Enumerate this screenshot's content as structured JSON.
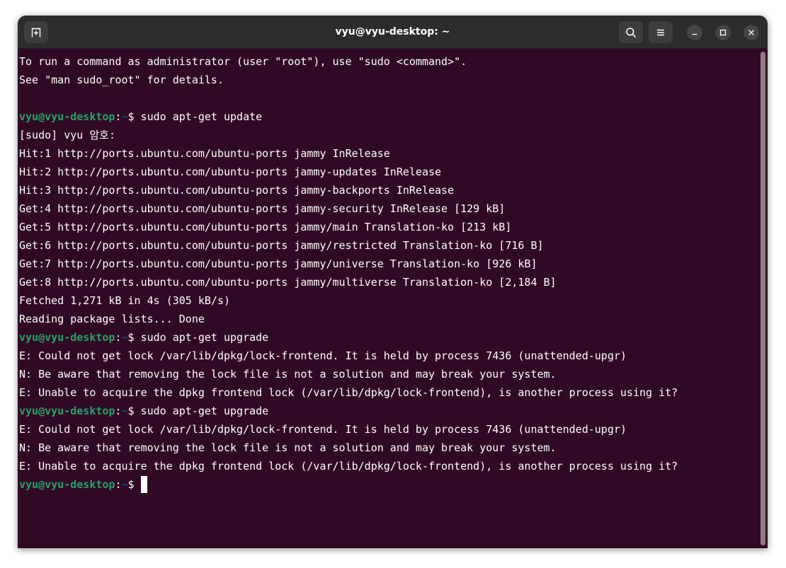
{
  "window": {
    "title": "vyu@vyu-desktop: ~"
  },
  "titlebar": {
    "new_tab_icon": "new-tab-icon",
    "search_icon": "search-icon",
    "menu_icon": "hamburger-menu-icon",
    "minimize_icon": "minimize-icon",
    "maximize_icon": "maximize-icon",
    "close_icon": "close-icon"
  },
  "colors": {
    "terminal_bg": "#300a24",
    "prompt_user": "#26a269",
    "prompt_path": "#12488b",
    "text": "#ffffff"
  },
  "prompt": {
    "user": "vyu@vyu-desktop",
    "colon": ":",
    "path": "~",
    "dollar": "$ "
  },
  "terminal": {
    "lines": [
      {
        "type": "text",
        "text": "To run a command as administrator (user \"root\"), use \"sudo <command>\"."
      },
      {
        "type": "text",
        "text": "See \"man sudo_root\" for details."
      },
      {
        "type": "text",
        "text": ""
      },
      {
        "type": "prompt",
        "command": "sudo apt-get update"
      },
      {
        "type": "text",
        "text": "[sudo] vyu 암호:"
      },
      {
        "type": "text",
        "text": "Hit:1 http://ports.ubuntu.com/ubuntu-ports jammy InRelease"
      },
      {
        "type": "text",
        "text": "Hit:2 http://ports.ubuntu.com/ubuntu-ports jammy-updates InRelease"
      },
      {
        "type": "text",
        "text": "Hit:3 http://ports.ubuntu.com/ubuntu-ports jammy-backports InRelease"
      },
      {
        "type": "text",
        "text": "Get:4 http://ports.ubuntu.com/ubuntu-ports jammy-security InRelease [129 kB]"
      },
      {
        "type": "text",
        "text": "Get:5 http://ports.ubuntu.com/ubuntu-ports jammy/main Translation-ko [213 kB]"
      },
      {
        "type": "text",
        "text": "Get:6 http://ports.ubuntu.com/ubuntu-ports jammy/restricted Translation-ko [716 B]"
      },
      {
        "type": "text",
        "text": "Get:7 http://ports.ubuntu.com/ubuntu-ports jammy/universe Translation-ko [926 kB]"
      },
      {
        "type": "text",
        "text": "Get:8 http://ports.ubuntu.com/ubuntu-ports jammy/multiverse Translation-ko [2,184 B]"
      },
      {
        "type": "text",
        "text": "Fetched 1,271 kB in 4s (305 kB/s)"
      },
      {
        "type": "text",
        "text": "Reading package lists... Done"
      },
      {
        "type": "prompt",
        "command": "sudo apt-get upgrade"
      },
      {
        "type": "text",
        "text": "E: Could not get lock /var/lib/dpkg/lock-frontend. It is held by process 7436 (unattended-upgr)"
      },
      {
        "type": "text",
        "text": "N: Be aware that removing the lock file is not a solution and may break your system."
      },
      {
        "type": "text",
        "text": "E: Unable to acquire the dpkg frontend lock (/var/lib/dpkg/lock-frontend), is another process using it?"
      },
      {
        "type": "prompt",
        "command": "sudo apt-get upgrade"
      },
      {
        "type": "text",
        "text": "E: Could not get lock /var/lib/dpkg/lock-frontend. It is held by process 7436 (unattended-upgr)"
      },
      {
        "type": "text",
        "text": "N: Be aware that removing the lock file is not a solution and may break your system."
      },
      {
        "type": "text",
        "text": "E: Unable to acquire the dpkg frontend lock (/var/lib/dpkg/lock-frontend), is another process using it?"
      },
      {
        "type": "prompt",
        "command": "",
        "cursor": true
      }
    ]
  }
}
